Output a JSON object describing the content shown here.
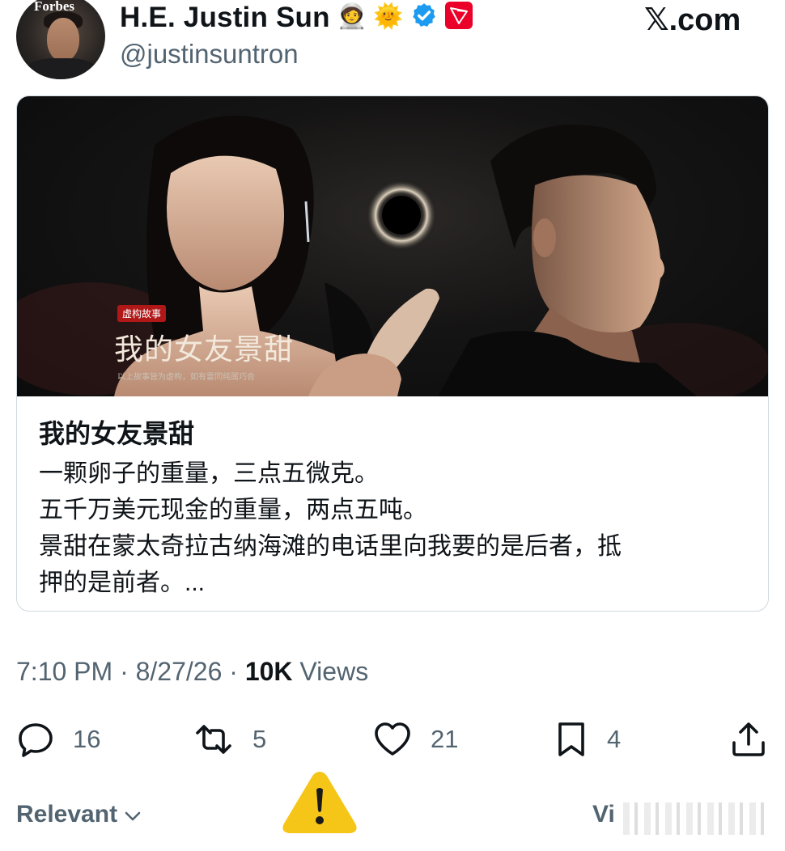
{
  "header": {
    "avatar_text": "Forbes",
    "name": "H.E. Justin Sun",
    "badge_emojis": [
      "🧑‍🚀",
      "🌞"
    ],
    "handle": "@justinsuntron",
    "site": "𝕏.com"
  },
  "card": {
    "poster": {
      "tag": "虚构故事",
      "title": "我的女友景甜",
      "caption": "以上故事皆为虚构，如有雷同纯属巧合"
    },
    "title": "我的女友景甜",
    "body_lines": [
      "一颗卵子的重量，三点五微克。",
      "五千万美元现金的重量，两点五吨。",
      "景甜在蒙太奇拉古纳海滩的电话里向我要的是后者，抵",
      "押的是前者。..."
    ]
  },
  "meta": {
    "time": "7:10 PM",
    "separator": " · ",
    "date": "8/27/26",
    "views_count": "10K",
    "views_label": " Views"
  },
  "actions": {
    "replies": "16",
    "reposts": "5",
    "likes": "21",
    "bookmarks": "4"
  },
  "footer": {
    "sort_label": "Relevant",
    "view_label": "Vi"
  },
  "colors": {
    "text": "#0f1419",
    "secondary": "#536471",
    "verified": "#1d9bf0",
    "tron": "#eb0029",
    "warning": "#f5c518"
  },
  "icons": [
    "verified-badge-icon",
    "tron-logo-icon",
    "reply-icon",
    "repost-icon",
    "like-icon",
    "bookmark-icon",
    "share-icon",
    "chevron-down-icon",
    "warning-icon"
  ]
}
